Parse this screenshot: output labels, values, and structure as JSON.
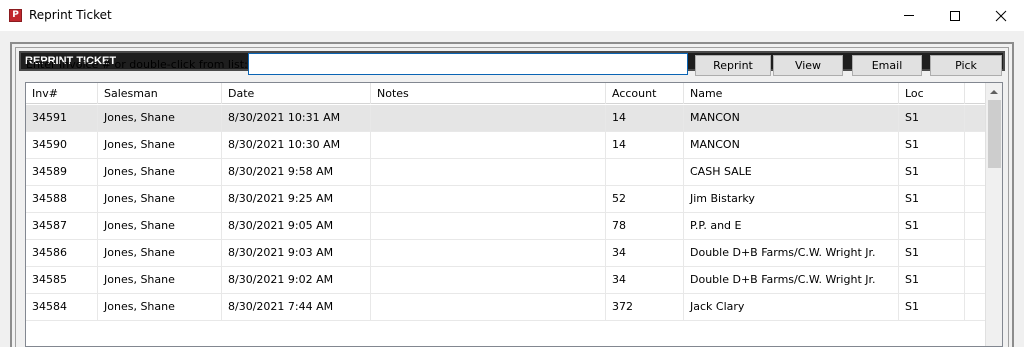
{
  "window": {
    "title": "Reprint Ticket",
    "icon_letter": "P"
  },
  "section": {
    "header": "REPRINT TICKET"
  },
  "search": {
    "label": "Enter Invoice # or double-click from list:",
    "value": "",
    "placeholder": ""
  },
  "buttons": {
    "reprint": "Reprint",
    "view": "View",
    "email": "Email",
    "pick": "Pick"
  },
  "table": {
    "columns": [
      "Inv#",
      "Salesman",
      "Date",
      "Notes",
      "Account",
      "Name",
      "Loc"
    ],
    "rows": [
      {
        "inv": "34591",
        "salesman": "Jones, Shane",
        "date": "8/30/2021 10:31 AM",
        "notes": "",
        "account": "14",
        "name": "MANCON",
        "loc": "S1"
      },
      {
        "inv": "34590",
        "salesman": "Jones, Shane",
        "date": "8/30/2021 10:30 AM",
        "notes": "",
        "account": "14",
        "name": "MANCON",
        "loc": "S1"
      },
      {
        "inv": "34589",
        "salesman": "Jones, Shane",
        "date": "8/30/2021 9:58 AM",
        "notes": "",
        "account": "",
        "name": "CASH SALE",
        "loc": "S1"
      },
      {
        "inv": "34588",
        "salesman": "Jones, Shane",
        "date": "8/30/2021 9:25 AM",
        "notes": "",
        "account": "52",
        "name": "Jim Bistarky",
        "loc": "S1"
      },
      {
        "inv": "34587",
        "salesman": "Jones, Shane",
        "date": "8/30/2021 9:05 AM",
        "notes": "",
        "account": "78",
        "name": "P.P. and E",
        "loc": "S1"
      },
      {
        "inv": "34586",
        "salesman": "Jones, Shane",
        "date": "8/30/2021 9:03 AM",
        "notes": "",
        "account": "34",
        "name": "Double D+B Farms/C.W. Wright Jr.",
        "loc": "S1"
      },
      {
        "inv": "34585",
        "salesman": "Jones, Shane",
        "date": "8/30/2021 9:02 AM",
        "notes": "",
        "account": "34",
        "name": "Double D+B Farms/C.W. Wright Jr.",
        "loc": "S1"
      },
      {
        "inv": "34584",
        "salesman": "Jones, Shane",
        "date": "8/30/2021 7:44 AM",
        "notes": "",
        "account": "372",
        "name": "Jack Clary",
        "loc": "S1"
      }
    ]
  },
  "colors": {
    "header_bg": "#1e1e1e",
    "selected_row": "#e5e5e5",
    "input_border": "#0a64b4",
    "icon_red": "#c1272d"
  }
}
